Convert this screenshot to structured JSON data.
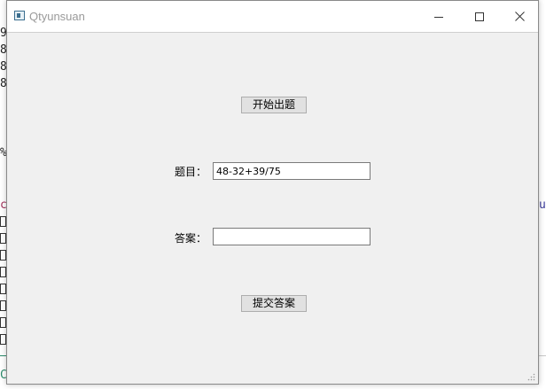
{
  "window": {
    "title": "Qtyunsuan",
    "controls": [
      "minimize-icon",
      "maximize-icon",
      "close-icon"
    ]
  },
  "main": {
    "start_button_label": "开始出题",
    "question_label": "题目：",
    "question_value": "48-32+39/75",
    "answer_label": "答案：",
    "answer_value": "",
    "submit_button_label": "提交答案"
  },
  "background": {
    "left_glyphs": [
      "9",
      "8",
      "8",
      "8",
      "%",
      "c",
      "C"
    ],
    "right_glyphs": [
      "u"
    ]
  },
  "colors": {
    "window_bg": "#f0f0f0",
    "titlebar_bg": "#ffffff",
    "button_bg": "#e1e1e1",
    "title_text": "#9a9a9a"
  }
}
